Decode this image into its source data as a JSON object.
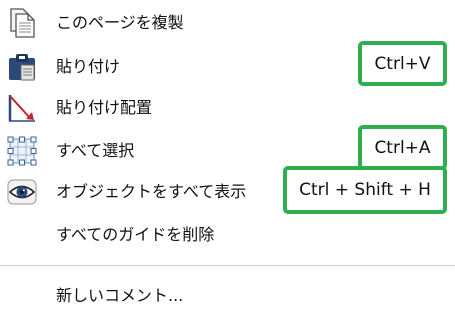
{
  "menu": {
    "items": [
      {
        "label": "このページを複製",
        "icon": "duplicate-page-icon",
        "shortcut": ""
      },
      {
        "label": "貼り付け",
        "icon": "clipboard-icon",
        "shortcut": "Ctrl+V"
      },
      {
        "label": "貼り付け配置",
        "icon": "paste-in-place-icon",
        "shortcut": ""
      },
      {
        "label": "すべて選択",
        "icon": "select-all-icon",
        "shortcut": "Ctrl+A"
      },
      {
        "label": "オブジェクトをすべて表示",
        "icon": "eye-icon",
        "shortcut": "Ctrl + Shift + H"
      },
      {
        "label": "すべてのガイドを削除",
        "icon": "",
        "shortcut": ""
      },
      {
        "label": "新しいコメント...",
        "icon": "",
        "shortcut": ""
      }
    ]
  },
  "colors": {
    "highlight_border": "#2fae4d",
    "icon_blue": "#2b4a7a",
    "icon_red": "#c0262d"
  }
}
